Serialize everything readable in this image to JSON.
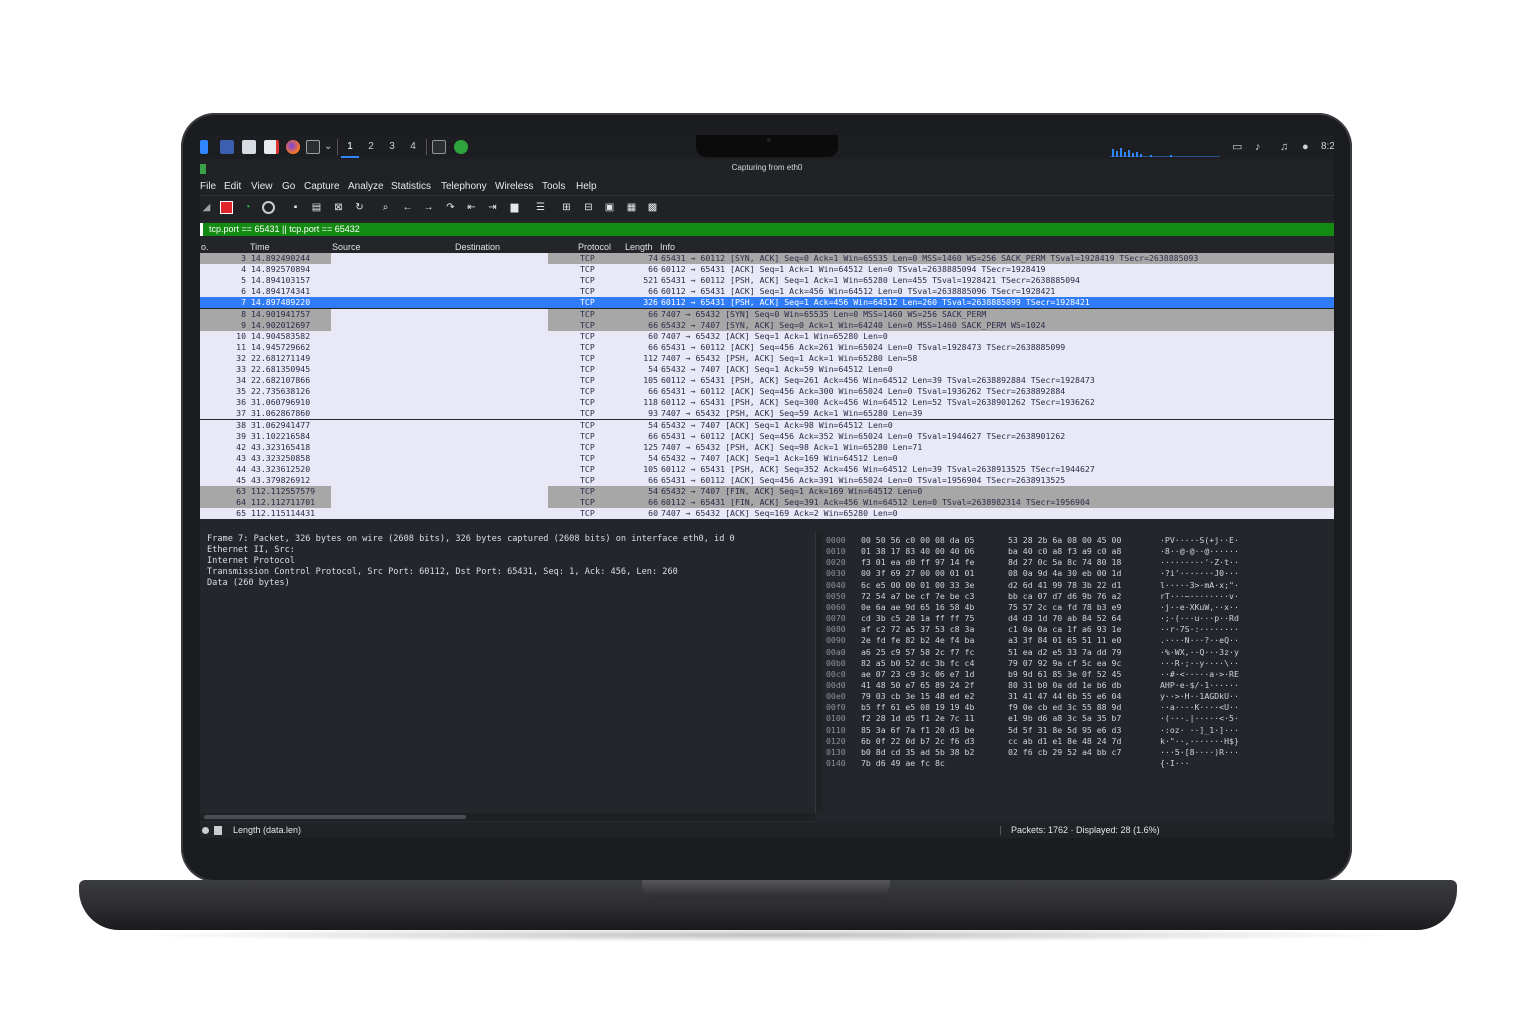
{
  "window": {
    "title": "Capturing from eth0"
  },
  "taskbar": {
    "workspaces": [
      "1",
      "2",
      "3",
      "4"
    ],
    "active_workspace": "1",
    "clock": "8:2",
    "icons": [
      "kali-menu-icon",
      "desktop-icon",
      "file-manager-icon",
      "text-editor-icon",
      "firefox-icon",
      "terminal-icon",
      "terminal-dropdown-icon",
      "wireshark-task-icon"
    ],
    "tray_icons": [
      "window-icon",
      "volume-icon",
      "notification-bell-icon",
      "power-icon"
    ]
  },
  "menu": [
    "File",
    "Edit",
    "View",
    "Go",
    "Capture",
    "Analyze",
    "Statistics",
    "Telephony",
    "Wireless",
    "Tools",
    "Help"
  ],
  "filter": {
    "value": "tcp.port == 65431 || tcp.port == 65432"
  },
  "packet_list": {
    "columns": {
      "no": "o.",
      "time": "Time",
      "source": "Source",
      "destination": "Destination",
      "protocol": "Protocol",
      "length": "Length",
      "info": "Info"
    },
    "selected_index": 4,
    "rows": [
      {
        "no": "3",
        "time": "14.892490244",
        "proto": "TCP",
        "len": "74",
        "info": "65431 → 60112 [SYN, ACK] Seq=0 Ack=1 Win=65535 Len=0 MSS=1460 WS=256 SACK_PERM TSval=1928419 TSecr=2638885093",
        "style": "gray"
      },
      {
        "no": "4",
        "time": "14.892570894",
        "proto": "TCP",
        "len": "66",
        "info": "60112 → 65431 [ACK] Seq=1 Ack=1 Win=64512 Len=0 TSval=2638885094 TSecr=1928419",
        "style": "normal"
      },
      {
        "no": "5",
        "time": "14.894103157",
        "proto": "TCP",
        "len": "521",
        "info": "65431 → 60112 [PSH, ACK] Seq=1 Ack=1 Win=65280 Len=455 TSval=1928421 TSecr=2638885094",
        "style": "normal"
      },
      {
        "no": "6",
        "time": "14.894174341",
        "proto": "TCP",
        "len": "66",
        "info": "60112 → 65431 [ACK] Seq=1 Ack=456 Win=64512 Len=0 TSval=2638885096 TSecr=1928421",
        "style": "normal"
      },
      {
        "no": "7",
        "time": "14.897489220",
        "proto": "TCP",
        "len": "326",
        "info": "60112 → 65431 [PSH, ACK] Seq=1 Ack=456 Win=64512 Len=260 TSval=2638885099 TSecr=1928421",
        "style": "selected"
      },
      {
        "no": "8",
        "time": "14.901941757",
        "proto": "TCP",
        "len": "66",
        "info": "7407 → 65432 [SYN] Seq=0 Win=65535 Len=0 MSS=1460 WS=256 SACK_PERM",
        "style": "gray"
      },
      {
        "no": "9",
        "time": "14.902012697",
        "proto": "TCP",
        "len": "66",
        "info": "65432 → 7407 [SYN, ACK] Seq=0 Ack=1 Win=64240 Len=0 MSS=1460 SACK_PERM WS=1024",
        "style": "gray"
      },
      {
        "no": "10",
        "time": "14.904583582",
        "proto": "TCP",
        "len": "60",
        "info": "7407 → 65432 [ACK] Seq=1 Ack=1 Win=65280 Len=0",
        "style": "normal"
      },
      {
        "no": "11",
        "time": "14.945729662",
        "proto": "TCP",
        "len": "66",
        "info": "65431 → 60112 [ACK] Seq=456 Ack=261 Win=65024 Len=0 TSval=1928473 TSecr=2638885099",
        "style": "normal"
      },
      {
        "no": "32",
        "time": "22.681271149",
        "proto": "TCP",
        "len": "112",
        "info": "7407 → 65432 [PSH, ACK] Seq=1 Ack=1 Win=65280 Len=58",
        "style": "normal"
      },
      {
        "no": "33",
        "time": "22.681350945",
        "proto": "TCP",
        "len": "54",
        "info": "65432 → 7407 [ACK] Seq=1 Ack=59 Win=64512 Len=0",
        "style": "normal"
      },
      {
        "no": "34",
        "time": "22.682107866",
        "proto": "TCP",
        "len": "105",
        "info": "60112 → 65431 [PSH, ACK] Seq=261 Ack=456 Win=64512 Len=39 TSval=2638892884 TSecr=1928473",
        "style": "normal"
      },
      {
        "no": "35",
        "time": "22.735638126",
        "proto": "TCP",
        "len": "66",
        "info": "65431 → 60112 [ACK] Seq=456 Ack=300 Win=65024 Len=0 TSval=1936262 TSecr=2638892884",
        "style": "normal"
      },
      {
        "no": "36",
        "time": "31.060796910",
        "proto": "TCP",
        "len": "118",
        "info": "60112 → 65431 [PSH, ACK] Seq=300 Ack=456 Win=64512 Len=52 TSval=2638901262 TSecr=1936262",
        "style": "normal"
      },
      {
        "no": "37",
        "time": "31.062867860",
        "proto": "TCP",
        "len": "93",
        "info": "7407 → 65432 [PSH, ACK] Seq=59 Ack=1 Win=65280 Len=39",
        "style": "normal"
      },
      {
        "no": "38",
        "time": "31.062941477",
        "proto": "TCP",
        "len": "54",
        "info": "65432 → 7407 [ACK] Seq=1 Ack=98 Win=64512 Len=0",
        "style": "normal"
      },
      {
        "no": "39",
        "time": "31.102216584",
        "proto": "TCP",
        "len": "66",
        "info": "65431 → 60112 [ACK] Seq=456 Ack=352 Win=65024 Len=0 TSval=1944627 TSecr=2638901262",
        "style": "normal"
      },
      {
        "no": "42",
        "time": "43.323165418",
        "proto": "TCP",
        "len": "125",
        "info": "7407 → 65432 [PSH, ACK] Seq=98 Ack=1 Win=65280 Len=71",
        "style": "normal"
      },
      {
        "no": "43",
        "time": "43.323250858",
        "proto": "TCP",
        "len": "54",
        "info": "65432 → 7407 [ACK] Seq=1 Ack=169 Win=64512 Len=0",
        "style": "normal"
      },
      {
        "no": "44",
        "time": "43.323612520",
        "proto": "TCP",
        "len": "105",
        "info": "60112 → 65431 [PSH, ACK] Seq=352 Ack=456 Win=64512 Len=39 TSval=2638913525 TSecr=1944627",
        "style": "normal"
      },
      {
        "no": "45",
        "time": "43.379826912",
        "proto": "TCP",
        "len": "66",
        "info": "65431 → 60112 [ACK] Seq=456 Ack=391 Win=65024 Len=0 TSval=1956904 TSecr=2638913525",
        "style": "normal"
      },
      {
        "no": "63",
        "time": "112.112557579",
        "proto": "TCP",
        "len": "54",
        "info": "65432 → 7407 [FIN, ACK] Seq=1 Ack=169 Win=64512 Len=0",
        "style": "gray"
      },
      {
        "no": "64",
        "time": "112.112711701",
        "proto": "TCP",
        "len": "66",
        "info": "60112 → 65431 [FIN, ACK] Seq=391 Ack=456 Win=64512 Len=0 TSval=2638982314 TSecr=1956904",
        "style": "gray"
      },
      {
        "no": "65",
        "time": "112.115114431",
        "proto": "TCP",
        "len": "60",
        "info": "7407 → 65432 [ACK] Seq=169 Ack=2 Win=65280 Len=0",
        "style": "normal"
      }
    ]
  },
  "details": [
    "Frame 7: Packet, 326 bytes on wire (2608 bits), 326 bytes captured (2608 bits) on interface eth0, id 0",
    "Ethernet II, Src:",
    "Internet Protocol",
    "Transmission Control Protocol, Src Port: 60112, Dst Port: 65431, Seq: 1, Ack: 456, Len: 260",
    "Data (260 bytes)"
  ],
  "hex": [
    {
      "off": "0000",
      "b1": "00 50 56 c0 00 08 da 05",
      "b2": "53 28 2b 6a 08 00 45 00",
      "ascii": "·PV·····S(+j··E·"
    },
    {
      "off": "0010",
      "b1": "01 38 17 83 40 00 40 06",
      "b2": "ba 40 c0 a8 f3 a9 c0 a8",
      "ascii": "·8··@·@··@······"
    },
    {
      "off": "0020",
      "b1": "f3 01 ea d0 ff 97 14 fe",
      "b2": "8d 27 0c 5a 8c 74 80 18",
      "ascii": "·········'·Z·t··"
    },
    {
      "off": "0030",
      "b1": "00 3f 69 27 00 00 01 01",
      "b2": "08 0a 9d 4a 30 eb 00 1d",
      "ascii": "·?i'·······J0···"
    },
    {
      "off": "0040",
      "b1": "6c e5 00 00 01 00 33 3e",
      "b2": "d2 6d 41 99 78 3b 22 d1",
      "ascii": "l·····3>·mA·x;\"·"
    },
    {
      "off": "0050",
      "b1": "72 54 a7 be cf 7e be c3",
      "b2": "bb ca 07 d7 d6 9b 76 a2",
      "ascii": "rT···~········v·"
    },
    {
      "off": "0060",
      "b1": "0e 6a ae 9d 65 16 58 4b",
      "b2": "75 57 2c ca fd 78 b3 e9",
      "ascii": "·j··e·XKuW,··x··"
    },
    {
      "off": "0070",
      "b1": "cd 3b c5 28 1a ff ff 75",
      "b2": "d4 d3 1d 70 ab 84 52 64",
      "ascii": "·;·(···u···p··Rd"
    },
    {
      "off": "0080",
      "b1": "af c2 72 a5 37 53 c8 3a",
      "b2": "c1 0a 0a ca 1f a6 93 1e",
      "ascii": "··r·7S·:········"
    },
    {
      "off": "0090",
      "b1": "2e fd fe 82 b2 4e f4 ba",
      "b2": "a3 3f 84 01 65 51 11 e0",
      "ascii": ".····N···?··eQ··"
    },
    {
      "off": "00a0",
      "b1": "a6 25 c9 57 58 2c f7 fc",
      "b2": "51 ea d2 e5 33 7a dd 79",
      "ascii": "·%·WX,··Q···3z·y"
    },
    {
      "off": "00b0",
      "b1": "82 a5 b0 52 dc 3b fc c4",
      "b2": "79 07 92 9a cf 5c ea 9c",
      "ascii": "···R·;··y····\\··"
    },
    {
      "off": "00c0",
      "b1": "ae 07 23 c9 3c 06 e7 1d",
      "b2": "b9 9d 61 85 3e 0f 52 45",
      "ascii": "··#·<·····a·>·RE"
    },
    {
      "off": "00d0",
      "b1": "41 48 50 e7 65 89 24 2f",
      "b2": "80 31 b0 0a dd 1e b6 db",
      "ascii": "AHP·e·$/·1······"
    },
    {
      "off": "00e0",
      "b1": "79 03 cb 3e 15 48 ed e2",
      "b2": "31 41 47 44 6b 55 e6 04",
      "ascii": "y··>·H··1AGDkU··"
    },
    {
      "off": "00f0",
      "b1": "b5 ff 61 e5 08 19 19 4b",
      "b2": "f9 0e cb ed 3c 55 88 9d",
      "ascii": "··a····K····<U··"
    },
    {
      "off": "0100",
      "b1": "f2 28 1d d5 f1 2e 7c 11",
      "b2": "e1 9b d6 a8 3c 5a 35 b7",
      "ascii": "·(···.|·····<·5·"
    },
    {
      "off": "0110",
      "b1": "85 3a 6f 7a f1 20 d3 be",
      "b2": "5d 5f 31 8e 5d 95 e6 d3",
      "ascii": "·:oz· ··]_1·]···"
    },
    {
      "off": "0120",
      "b1": "6b 0f 22 0d b7 2c f6 d3",
      "b2": "cc ab d1 e1 8e 48 24 7d",
      "ascii": "k·\"··,·······H$}"
    },
    {
      "off": "0130",
      "b1": "b0 8d cd 35 ad 5b 38 b2",
      "b2": "02 f6 cb 29 52 a4 bb c7",
      "ascii": "···5·[8····)R···"
    },
    {
      "off": "0140",
      "b1": "7b d6 49 ae fc 8c",
      "b2": "",
      "ascii": "{·I···"
    }
  ],
  "status": {
    "left": "Length (data.len)",
    "right": "Packets: 1762 · Displayed: 28 (1.6%)"
  },
  "colors": {
    "filter_ok": "#138a12",
    "row_normal": "#e8e8f6",
    "row_gray": "#a7a7a7",
    "row_selected": "#2f7cf6",
    "text_dark": "#2b2b48"
  }
}
